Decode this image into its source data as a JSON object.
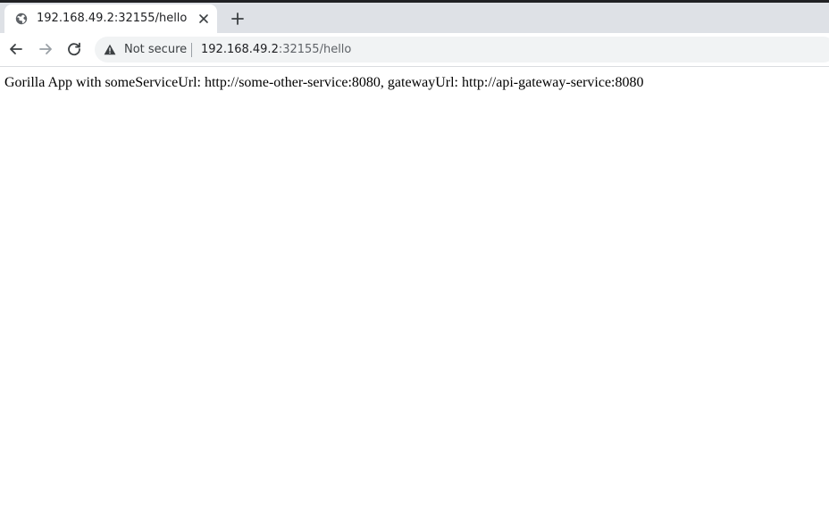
{
  "browser": {
    "tab": {
      "title": "192.168.49.2:32155/hello",
      "favicon": "globe-icon",
      "close_icon": "close-icon"
    },
    "new_tab_icon": "plus-icon",
    "toolbar": {
      "back_icon": "arrow-left-icon",
      "forward_icon": "arrow-right-icon",
      "reload_icon": "reload-icon"
    },
    "omnibox": {
      "security_icon": "warning-icon",
      "security_label": "Not secure",
      "url_host": "192.168.49.2",
      "url_rest": ":32155/hello"
    }
  },
  "page": {
    "text": "Gorilla App with someServiceUrl: http://some-other-service:8080, gatewayUrl: http://api-gateway-service:8080"
  },
  "colors": {
    "tabstrip": "#dee1e6",
    "omnibox": "#f1f3f4",
    "text_primary": "#202124",
    "text_secondary": "#5f6368"
  }
}
